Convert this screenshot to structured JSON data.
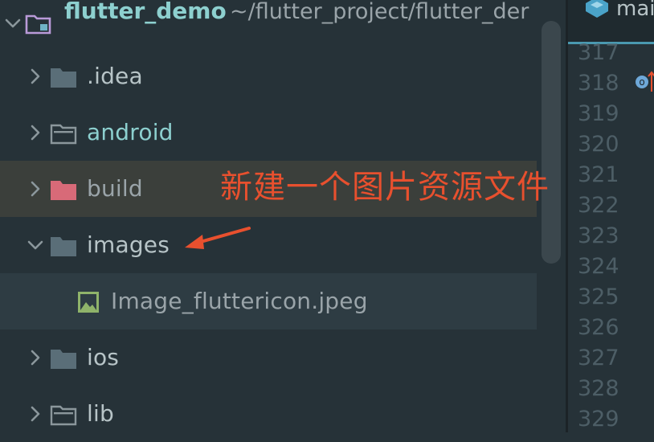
{
  "project": {
    "root": {
      "name": "flutter_demo",
      "path": "~/flutter_project/flutter_der"
    },
    "items": [
      {
        "label": ".idea"
      },
      {
        "label": "android"
      },
      {
        "label": "build"
      },
      {
        "label": "images"
      },
      {
        "label": "Image_fluttericon.jpeg"
      },
      {
        "label": "ios"
      },
      {
        "label": "lib"
      }
    ]
  },
  "editor": {
    "tab_label": "mai",
    "line_numbers": [
      "317",
      "318",
      "319",
      "320",
      "321",
      "322",
      "323",
      "324",
      "325",
      "326",
      "327",
      "328",
      "329"
    ]
  },
  "annotation": {
    "text": "新建一个图片资源文件"
  },
  "colors": {
    "annotation": "#e8502e",
    "build_folder": "#d86a78",
    "folder_gray": "#5a6e78",
    "file_green": "#8fb36a",
    "text": "#b7c4c7"
  }
}
